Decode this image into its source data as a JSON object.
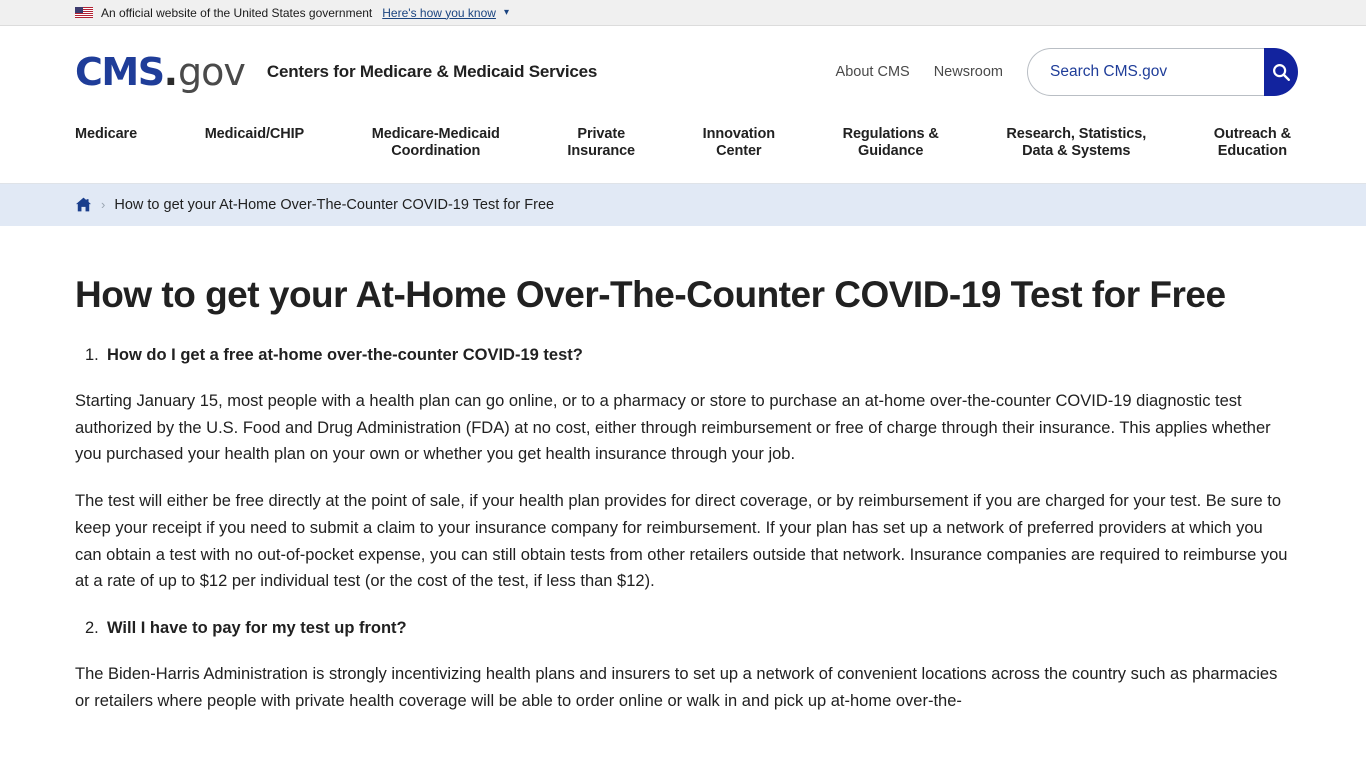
{
  "gov_banner": {
    "flag_icon": "us-flag-icon",
    "text": "An official website of the United States government",
    "link_label": "Here's how you know",
    "caret_icon": "chevron-down-icon"
  },
  "masthead": {
    "logo": {
      "cms": "CMS",
      "dot": ".",
      "gov": "gov"
    },
    "agency_name": "Centers for Medicare & Medicaid Services",
    "utility_links": [
      {
        "label": "About CMS"
      },
      {
        "label": "Newsroom"
      }
    ],
    "search": {
      "placeholder": "Search CMS.gov",
      "value": "",
      "button_icon": "search-icon"
    }
  },
  "main_nav": {
    "items": [
      {
        "label": "Medicare"
      },
      {
        "label": "Medicaid/CHIP"
      },
      {
        "label": "Medicare-Medicaid\nCoordination"
      },
      {
        "label": "Private\nInsurance"
      },
      {
        "label": "Innovation\nCenter"
      },
      {
        "label": "Regulations &\nGuidance"
      },
      {
        "label": "Research, Statistics,\nData & Systems"
      },
      {
        "label": "Outreach &\nEducation"
      }
    ]
  },
  "breadcrumb": {
    "home_icon": "home-icon",
    "separator": "›",
    "current": "How to get your At-Home Over-The-Counter COVID-19 Test for Free"
  },
  "article": {
    "title": "How to get your At-Home Over-The-Counter COVID-19 Test for Free",
    "questions": [
      {
        "number": "1.",
        "text": "How do I get a free at-home over-the-counter COVID-19 test?",
        "paragraphs": [
          "Starting January 15, most people with a health plan can go online, or to a pharmacy or store to purchase an at-home over-the-counter COVID-19 diagnostic test authorized by the U.S. Food and Drug Administration (FDA) at no cost, either through reimbursement or free of charge through their insurance. This applies whether you purchased your health plan on your own or whether you get health insurance through your job.",
          "The test will either be free directly at the point of sale, if your health plan provides for direct coverage, or by reimbursement if you are charged for your test. Be sure to keep your receipt if you need to submit a claim to your insurance company for reimbursement. If your plan has set up a network of preferred providers at which you can obtain a test with no out-of-pocket expense, you can still obtain tests from other retailers outside that network. Insurance companies are required to reimburse you at a rate of up to $12 per individual test (or the cost of the test, if less than $12)."
        ]
      },
      {
        "number": "2.",
        "text": "Will I have to pay for my test up front?",
        "paragraphs": [
          "The Biden-Harris Administration is strongly incentivizing health plans and insurers to set up a network of convenient locations across the country such as pharmacies or retailers where people with private health coverage will be able to order online or walk in and pick up at-home over-the-"
        ]
      }
    ]
  },
  "colors": {
    "brand_blue": "#1f3d99",
    "search_button": "#12239e",
    "breadcrumb_bg": "#e1e9f5",
    "banner_bg": "#f0f0f0",
    "text": "#212121"
  }
}
